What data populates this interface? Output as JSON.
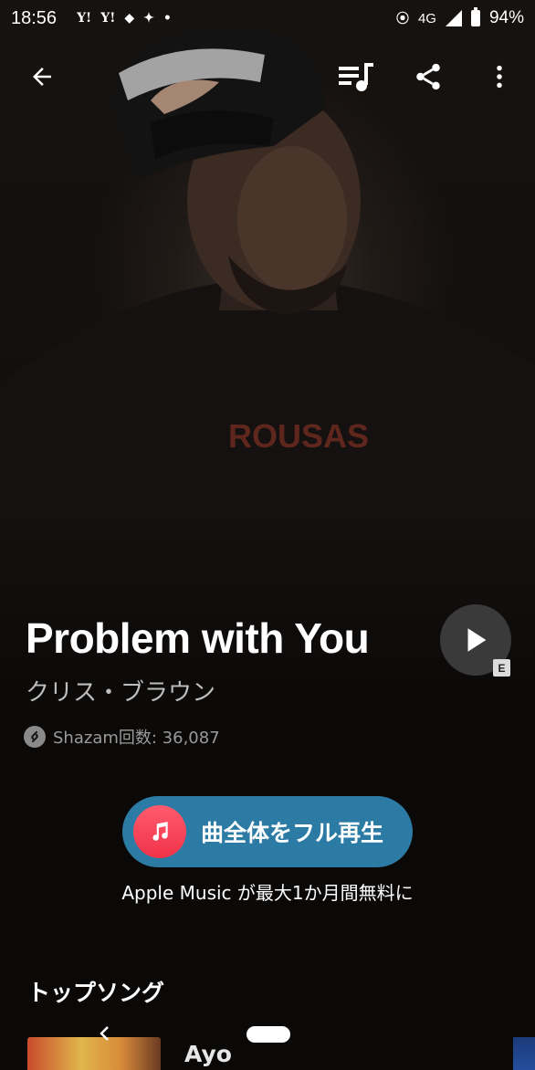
{
  "status_bar": {
    "time": "18:56",
    "notification_icons": [
      "Y!",
      "Y!",
      "cube-icon",
      "butterfly-icon",
      "dot-icon"
    ],
    "network": "4G",
    "battery": "94%"
  },
  "app_bar": {
    "back_icon": "back-arrow-icon",
    "queue_icon": "queue-music-icon",
    "share_icon": "share-icon",
    "more_icon": "more-vert-icon"
  },
  "song": {
    "title": "Problem with You",
    "artist": "クリス・ブラウン",
    "shazam_count": "Shazam回数: 36,087",
    "explicit_badge": "E"
  },
  "apple_music": {
    "button_label": "曲全体をフル再生",
    "promo": "Apple Music が最大1か月間無料に"
  },
  "top_songs": {
    "section_title": "トップソング",
    "items": [
      {
        "title": "Ayo"
      }
    ]
  },
  "colors": {
    "apple_music_button": "#2c7ba4",
    "apple_music_icon": "#f13249",
    "background": "#0b0908"
  }
}
